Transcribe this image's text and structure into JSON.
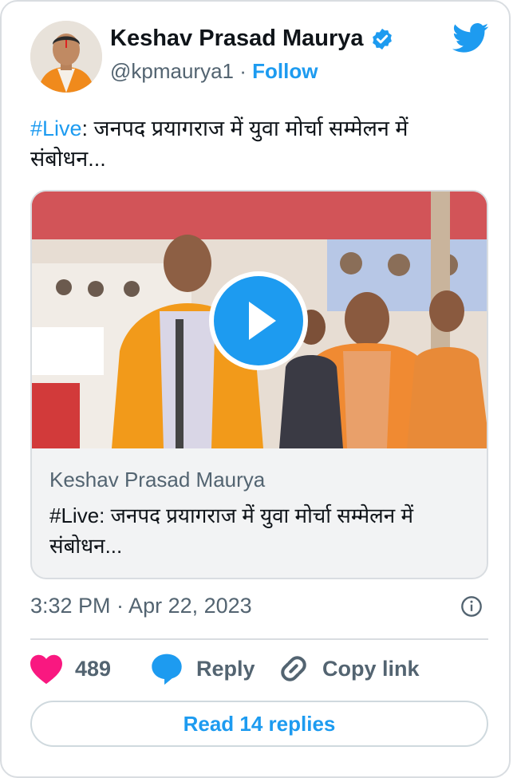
{
  "author": {
    "name": "Keshav Prasad Maurya",
    "handle": "@kpmaurya1",
    "separator": "·",
    "follow_label": "Follow",
    "verified": true
  },
  "tweet": {
    "hashtag": "#Live",
    "text": ": जनपद प्रयागराज में युवा मोर्चा सम्मेलन में संबोधन..."
  },
  "media": {
    "type": "video",
    "author": "Keshav Prasad Maurya",
    "description": "#Live: जनपद प्रयागराज में युवा मोर्चा सम्मेलन में संबोधन..."
  },
  "timestamp": "3:32 PM · Apr 22, 2023",
  "actions": {
    "likes_count": "489",
    "reply_label": "Reply",
    "copy_link_label": "Copy link"
  },
  "read_replies_label": "Read 14 replies",
  "colors": {
    "accent": "#1d9bf0",
    "like": "#f91880",
    "muted": "#536471"
  },
  "icons": [
    "twitter-bird-icon",
    "verified-badge-icon",
    "play-icon",
    "info-icon",
    "heart-icon",
    "reply-bubble-icon",
    "link-icon"
  ]
}
